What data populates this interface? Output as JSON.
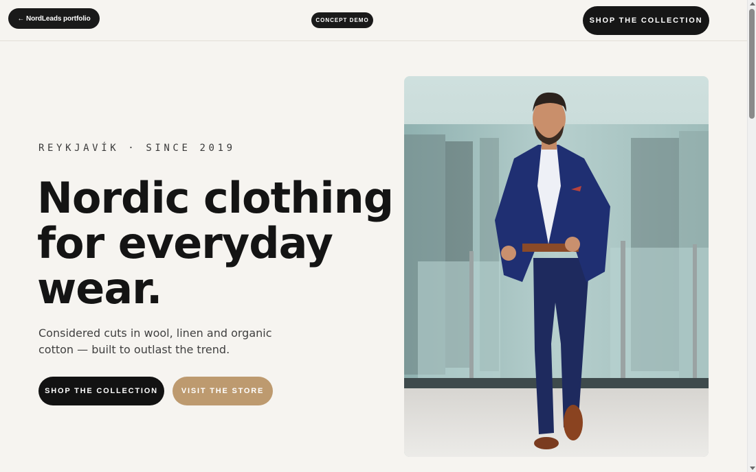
{
  "header": {
    "back_link_label": "← NordLeads portfolio",
    "badge_label": "CONCEPT DEMO",
    "shop_button_label": "SHOP THE COLLECTION"
  },
  "hero": {
    "eyebrow": "REYKJAVÍK · SINCE 2019",
    "headline_lines": [
      "Nordic clothing",
      "for everyday",
      "wear."
    ],
    "subtitle": "Considered cuts in wool, linen and organic cotton — built to outlast the trend.",
    "primary_cta": "SHOP THE COLLECTION",
    "secondary_cta": "VISIT THE STORE",
    "photo_subject": "man-in-navy-suit-photo"
  },
  "colors": {
    "background": "#f6f4f0",
    "dark_button": "#161616",
    "accent_button": "#bd9a6f",
    "text": "#141414"
  }
}
